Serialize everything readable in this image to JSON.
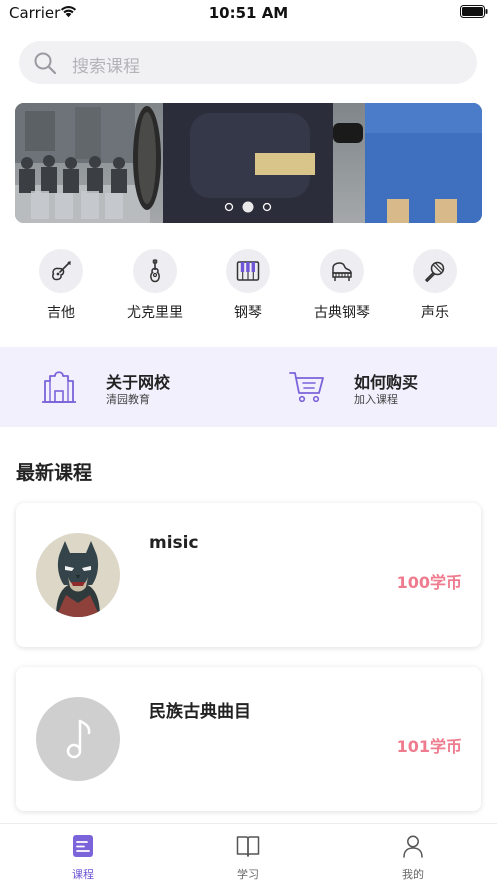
{
  "status_bar": {
    "carrier": "Carrier",
    "time": "10:51 AM"
  },
  "search": {
    "placeholder": "搜索课程"
  },
  "banner": {
    "page_count": 3,
    "active_page": 2
  },
  "categories": [
    {
      "label": "吉他",
      "icon": "guitar-icon"
    },
    {
      "label": "尤克里里",
      "icon": "ukulele-icon"
    },
    {
      "label": "钢琴",
      "icon": "piano-keys-icon"
    },
    {
      "label": "古典钢琴",
      "icon": "grand-piano-icon"
    },
    {
      "label": "声乐",
      "icon": "microphone-icon"
    }
  ],
  "info_strip": {
    "about": {
      "title": "关于网校",
      "subtitle": "清园教育",
      "icon": "school-building-icon"
    },
    "buy": {
      "title": "如何购买",
      "subtitle": "加入课程",
      "icon": "shopping-cart-icon"
    }
  },
  "latest_courses": {
    "title": "最新课程",
    "items": [
      {
        "title": "misic",
        "price": "100学币",
        "thumb": "batman-avatar"
      },
      {
        "title": "民族古典曲目",
        "price": "101学币",
        "thumb": "music-note-placeholder"
      }
    ]
  },
  "tab_bar": {
    "items": [
      {
        "label": "课程",
        "icon": "course-list-icon",
        "active": true
      },
      {
        "label": "学习",
        "icon": "open-book-icon",
        "active": false
      },
      {
        "label": "我的",
        "icon": "person-icon",
        "active": false
      }
    ]
  },
  "colors": {
    "accent": "#6e56d6",
    "price": "#ef7c8e",
    "info_strip_bg": "#f3f0fd",
    "search_bg": "#f1f1f3",
    "category_circle": "#eeeef2"
  }
}
